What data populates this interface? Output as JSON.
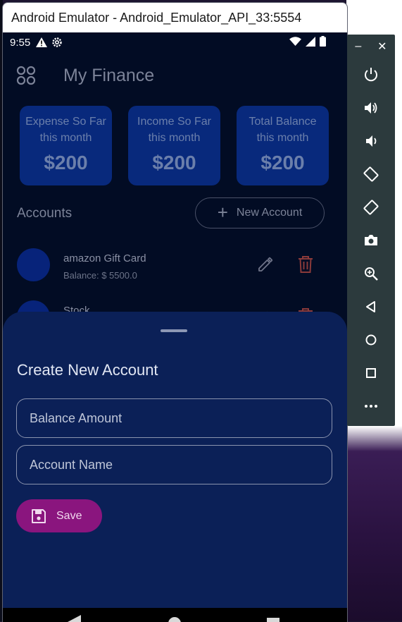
{
  "window": {
    "title": "Android Emulator - Android_Emulator_API_33:5554"
  },
  "status_bar": {
    "time": "9:55",
    "icons_left": [
      "warning-icon",
      "settings-icon"
    ],
    "icons_right": [
      "wifi-icon",
      "signal-icon",
      "battery-icon"
    ]
  },
  "app_bar": {
    "title": "My Finance",
    "menu_icon": "grid-menu-icon"
  },
  "summary_cards": [
    {
      "label": "Expense So Far this month",
      "value": "$200"
    },
    {
      "label": "Income So Far this month",
      "value": "$200"
    },
    {
      "label": "Total Balance this month",
      "value": "$200"
    }
  ],
  "accounts": {
    "title": "Accounts",
    "new_account_label": "New Account",
    "items": [
      {
        "name": "amazon Gift Card",
        "balance": "Balance: $ 5500.0"
      },
      {
        "name": "Stock",
        "balance": ""
      }
    ]
  },
  "sheet": {
    "title": "Create New Account",
    "balance_placeholder": "Balance Amount",
    "name_placeholder": "Account Name",
    "save_label": "Save"
  },
  "emulator_toolbar": {
    "minimize": "–",
    "close": "✕",
    "buttons": [
      "power-icon",
      "volume-up-icon",
      "volume-down-icon",
      "rotate-left-icon",
      "rotate-right-icon",
      "camera-icon",
      "zoom-icon",
      "back-icon",
      "home-icon",
      "overview-icon",
      "more-icon"
    ]
  },
  "colors": {
    "screen_bg": "#020c24",
    "card_bg": "#08297c",
    "sheet_bg": "#0b2057",
    "save_button": "#8a157e",
    "delete_icon": "#8a3a3a"
  }
}
